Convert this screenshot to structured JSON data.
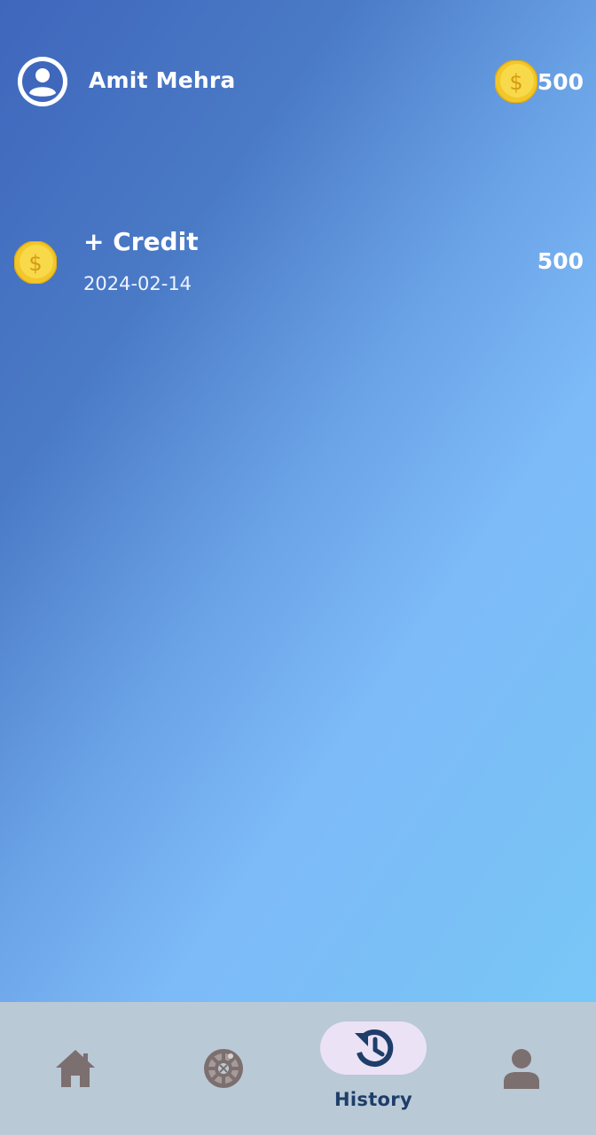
{
  "header": {
    "user_name": "Amit Mehra",
    "balance": "500",
    "avatar_icon": "user-avatar-icon",
    "coin_icon": "dollar-coin-icon"
  },
  "transactions": [
    {
      "type": "+ Credit",
      "date": "2024-02-14",
      "amount": "500",
      "icon": "dollar-coin-icon"
    }
  ],
  "bottom_nav": {
    "items": [
      {
        "id": "home",
        "icon": "home-icon",
        "label": "",
        "active": false
      },
      {
        "id": "games",
        "icon": "roulette-icon",
        "label": "",
        "active": false
      },
      {
        "id": "history",
        "icon": "history-icon",
        "label": "History",
        "active": true
      },
      {
        "id": "profile",
        "icon": "person-icon",
        "label": "",
        "active": false
      }
    ]
  },
  "colors": {
    "gradient_start": "#3f67bc",
    "gradient_end": "#78cbf8",
    "coin_gold": "#f5cf2c",
    "nav_background": "#b9c9d6",
    "active_pill": "#ebe2f6",
    "active_text": "#1e3e69",
    "inactive_icon": "#7c6f6f"
  }
}
